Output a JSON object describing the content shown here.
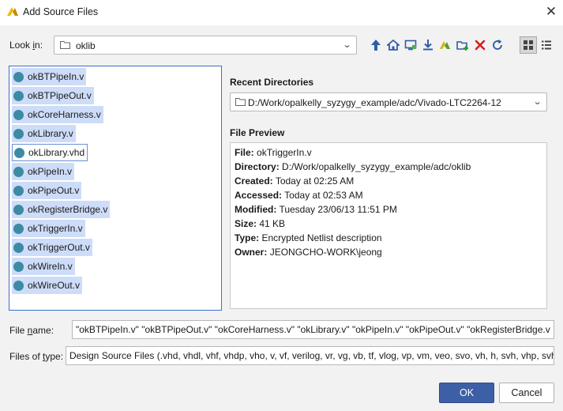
{
  "window": {
    "title": "Add Source Files"
  },
  "look_in": {
    "label_pre": "Look ",
    "label_key": "i",
    "label_post": "n:",
    "value": "oklib"
  },
  "toolbar": {
    "icons": [
      "up-arrow-icon",
      "home-icon",
      "desktop-icon",
      "download-icon",
      "project-icon",
      "new-folder-icon",
      "delete-icon",
      "refresh-icon",
      "grid-view-icon",
      "list-view-icon"
    ]
  },
  "files": [
    {
      "name": "okBTPipeIn.v",
      "state": "selected"
    },
    {
      "name": "okBTPipeOut.v",
      "state": "selected"
    },
    {
      "name": "okCoreHarness.v",
      "state": "selected"
    },
    {
      "name": "okLibrary.v",
      "state": "selected"
    },
    {
      "name": "okLibrary.vhd",
      "state": "focused"
    },
    {
      "name": "okPipeIn.v",
      "state": "selected"
    },
    {
      "name": "okPipeOut.v",
      "state": "selected"
    },
    {
      "name": "okRegisterBridge.v",
      "state": "selected"
    },
    {
      "name": "okTriggerIn.v",
      "state": "selected"
    },
    {
      "name": "okTriggerOut.v",
      "state": "selected"
    },
    {
      "name": "okWireIn.v",
      "state": "selected"
    },
    {
      "name": "okWireOut.v",
      "state": "selected"
    }
  ],
  "recent": {
    "title": "Recent Directories",
    "value": "D:/Work/opalkelly_syzygy_example/adc/Vivado-LTC2264-12"
  },
  "preview": {
    "title": "File Preview",
    "rows": [
      {
        "label": "File:",
        "value": "okTriggerIn.v"
      },
      {
        "label": "Directory:",
        "value": "D:/Work/opalkelly_syzygy_example/adc/oklib"
      },
      {
        "label": "Created:",
        "value": "Today at 02:25 AM"
      },
      {
        "label": "Accessed:",
        "value": "Today at 02:53 AM"
      },
      {
        "label": "Modified:",
        "value": "Tuesday 23/06/13 11:51 PM"
      },
      {
        "label": "Size:",
        "value": "41 KB"
      },
      {
        "label": "Type:",
        "value": "Encrypted Netlist description"
      },
      {
        "label": "Owner:",
        "value": "JEONGCHO-WORK\\jeong"
      }
    ]
  },
  "file_name": {
    "label_pre": "File ",
    "label_key": "n",
    "label_post": "ame:",
    "value": "\"okBTPipeIn.v\" \"okBTPipeOut.v\" \"okCoreHarness.v\" \"okLibrary.v\" \"okPipeIn.v\" \"okPipeOut.v\" \"okRegisterBridge.v"
  },
  "file_type": {
    "label_pre": "Files of ",
    "label_key": "t",
    "label_post": "ype:",
    "value": "Design Source Files (.vhd, vhdl, vhf, vhdp, vho, v, vf, verilog, vr, vg, vb, tf, vlog, vp, vm, veo, svo, vh, h, svh, vhp, svhp, ."
  },
  "buttons": {
    "ok": "OK",
    "cancel": "Cancel"
  },
  "colors": {
    "selection": "#cddcf8",
    "primary": "#3d5fa5",
    "file_dot": "#3d8aa3"
  }
}
